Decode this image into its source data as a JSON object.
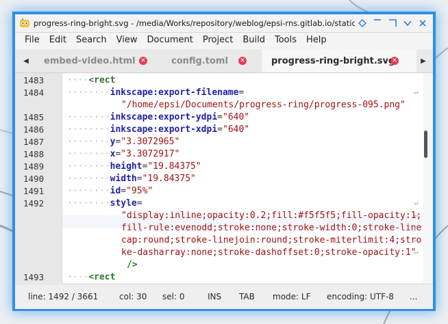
{
  "window": {
    "title": "progress-ring-bright.svg - /media/Works/repository/weblog/epsi-rns.gitlab.io/static/assets/posts/...",
    "controls": [
      "diamond-icon",
      "minimize-icon",
      "maximize-icon",
      "chevron-down-icon",
      "close-icon"
    ]
  },
  "menu": [
    "File",
    "Edit",
    "Search",
    "View",
    "Document",
    "Project",
    "Build",
    "Tools",
    "Help"
  ],
  "tabs": [
    {
      "label": "embed-video.html",
      "active": false
    },
    {
      "label": "config.toml",
      "active": false
    },
    {
      "label": "progress-ring-bright.svg",
      "active": true
    }
  ],
  "tab_close_glyph": "✕",
  "editor": {
    "line_numbers": [
      "1483",
      "1484",
      "",
      "1485",
      "1486",
      "1487",
      "1488",
      "1489",
      "1490",
      "1491",
      "1492",
      "",
      "",
      "",
      "",
      "1493"
    ],
    "lines": {
      "l1483": {
        "dots": "····",
        "tag": "<rect"
      },
      "l1484": {
        "dots": "········",
        "attr": "inkscape:export-filename",
        "eq": "="
      },
      "l1484b": {
        "str": "\"/home/epsi/Documents/progress-ring/progress-095.png\""
      },
      "l1485": {
        "dots": "········",
        "attr": "inkscape:export-ydpi",
        "eq": "=",
        "str": "\"640\""
      },
      "l1486": {
        "dots": "········",
        "attr": "inkscape:export-xdpi",
        "eq": "=",
        "str": "\"640\""
      },
      "l1487": {
        "dots": "········",
        "attr": "y",
        "eq": "=",
        "str": "\"3.3072965\""
      },
      "l1488": {
        "dots": "········",
        "attr": "x",
        "eq": "=",
        "str": "\"3.3072917\""
      },
      "l1489": {
        "dots": "········",
        "attr": "height",
        "eq": "=",
        "str": "\"19.84375\""
      },
      "l1490": {
        "dots": "········",
        "attr": "width",
        "eq": "=",
        "str": "\"19.84375\""
      },
      "l1491": {
        "dots": "········",
        "attr": "id",
        "eq": "=",
        "str": "\"95%\""
      },
      "l1492": {
        "dots": "········",
        "attr": "style",
        "eq": "="
      },
      "l1492b": {
        "str": "\"display:inline;opacity:0.2;fill:#f5f5f5;fill-opacity:1;"
      },
      "l1492c": {
        "str": "fill-rule:evenodd;stroke:none;stroke-width:0;stroke-line"
      },
      "l1492d": {
        "str": "cap:round;stroke-linejoin:round;stroke-miterlimit:4;stro"
      },
      "l1492e": {
        "str": "ke-dasharray:none;stroke-dashoffset:0;stroke-opacity:1\""
      },
      "l1492f": {
        "tag": "/>"
      },
      "l1493": {
        "dots": "····",
        "tag": "<rect"
      }
    },
    "wrap_glyph": "↵"
  },
  "status": {
    "line": "line: 1492 / 3661",
    "col": "col: 30",
    "sel": "sel: 0",
    "ins": "INS",
    "tab": "TAB",
    "mode": "mode: LF",
    "encoding": "encoding: UTF-8",
    "more": "..."
  },
  "colors": {
    "accent": "#2f8fe0",
    "tag": "#2d7a2d",
    "attr": "#1e1ea8",
    "string": "#a01010",
    "close": "#e53c52"
  }
}
